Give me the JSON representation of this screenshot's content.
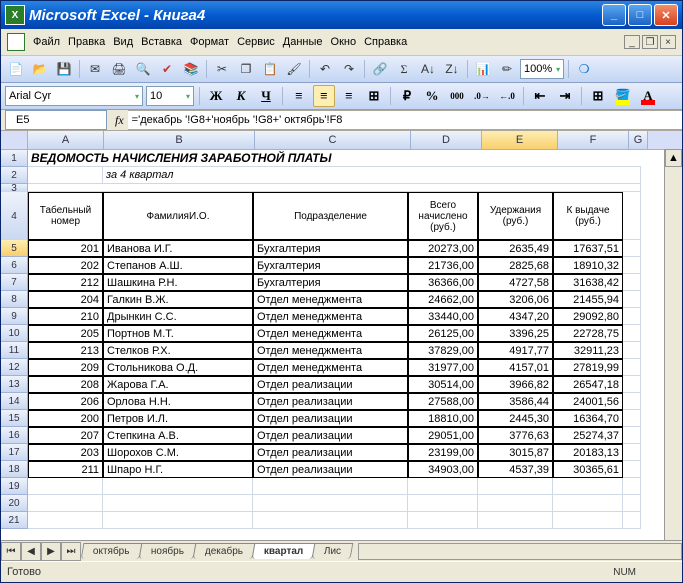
{
  "window": {
    "app": "Microsoft Excel",
    "doc": "Книга4"
  },
  "menus": [
    "Файл",
    "Правка",
    "Вид",
    "Вставка",
    "Формат",
    "Сервис",
    "Данные",
    "Окно",
    "Справка"
  ],
  "toolbar": {
    "zoom": "100%"
  },
  "format": {
    "font": "Arial Cyr",
    "size": "10"
  },
  "formula": {
    "namebox": "E5",
    "formula": "='декабрь '!G8+'ноябрь '!G8+' октябрь'!F8"
  },
  "columns": [
    "A",
    "B",
    "C",
    "D",
    "E",
    "F",
    "G"
  ],
  "title_row": "ВЕДОМОСТЬ НАЧИСЛЕНИЯ ЗАРАБОТНОЙ ПЛАТЫ",
  "subtitle": "за 4 квартал",
  "headers": {
    "tab_no": "Табельный номер",
    "fio": "ФамилияИ.О.",
    "dept": "Подразделение",
    "total": "Всего начислено (руб.)",
    "deduct": "Удержания (руб.)",
    "pay": "К выдаче (руб.)"
  },
  "data": [
    {
      "n": 201,
      "fio": "Иванова И.Г.",
      "dept": "Бухгалтерия",
      "total": "20273,00",
      "ded": "2635,49",
      "pay": "17637,51"
    },
    {
      "n": 202,
      "fio": "Степанов А.Ш.",
      "dept": "Бухгалтерия",
      "total": "21736,00",
      "ded": "2825,68",
      "pay": "18910,32"
    },
    {
      "n": 212,
      "fio": "Шашкина Р.Н.",
      "dept": "Бухгалтерия",
      "total": "36366,00",
      "ded": "4727,58",
      "pay": "31638,42"
    },
    {
      "n": 204,
      "fio": "Галкин В.Ж.",
      "dept": "Отдел менеджмента",
      "total": "24662,00",
      "ded": "3206,06",
      "pay": "21455,94"
    },
    {
      "n": 210,
      "fio": "Дрынкин С.С.",
      "dept": "Отдел менеджмента",
      "total": "33440,00",
      "ded": "4347,20",
      "pay": "29092,80"
    },
    {
      "n": 205,
      "fio": "Портнов М.Т.",
      "dept": "Отдел менеджмента",
      "total": "26125,00",
      "ded": "3396,25",
      "pay": "22728,75"
    },
    {
      "n": 213,
      "fio": "Стелков Р.Х.",
      "dept": "Отдел менеджмента",
      "total": "37829,00",
      "ded": "4917,77",
      "pay": "32911,23"
    },
    {
      "n": 209,
      "fio": "Стольникова О.Д.",
      "dept": "Отдел менеджмента",
      "total": "31977,00",
      "ded": "4157,01",
      "pay": "27819,99"
    },
    {
      "n": 208,
      "fio": "Жарова Г.А.",
      "dept": "Отдел реализации",
      "total": "30514,00",
      "ded": "3966,82",
      "pay": "26547,18"
    },
    {
      "n": 206,
      "fio": "Орлова Н.Н.",
      "dept": "Отдел реализации",
      "total": "27588,00",
      "ded": "3586,44",
      "pay": "24001,56"
    },
    {
      "n": 200,
      "fio": "Петров И.Л.",
      "dept": "Отдел реализации",
      "total": "18810,00",
      "ded": "2445,30",
      "pay": "16364,70"
    },
    {
      "n": 207,
      "fio": "Степкина А.В.",
      "dept": "Отдел реализации",
      "total": "29051,00",
      "ded": "3776,63",
      "pay": "25274,37"
    },
    {
      "n": 203,
      "fio": "Шорохов С.М.",
      "dept": "Отдел реализации",
      "total": "23199,00",
      "ded": "3015,87",
      "pay": "20183,13"
    },
    {
      "n": 211,
      "fio": "Шпаро Н.Г.",
      "dept": "Отдел реализации",
      "total": "34903,00",
      "ded": "4537,39",
      "pay": "30365,61"
    }
  ],
  "sheets": [
    "октябрь",
    "ноябрь",
    "декабрь",
    "квартал",
    "Лис"
  ],
  "active_sheet": "квартал",
  "status": {
    "ready": "Готово",
    "num": "NUM"
  }
}
